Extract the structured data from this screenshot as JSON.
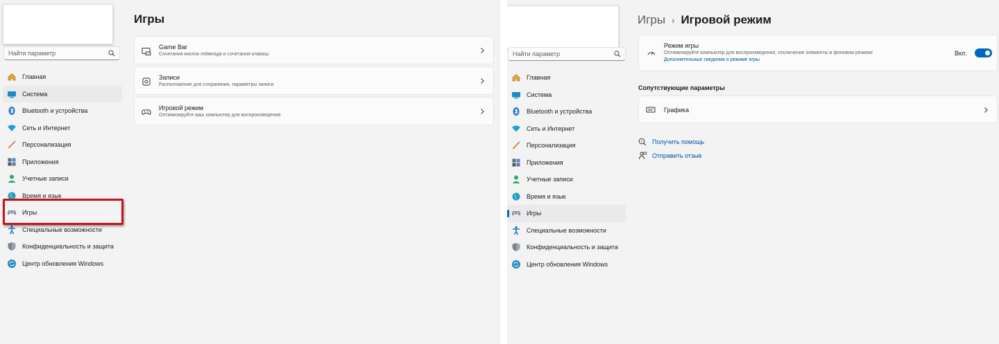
{
  "search": {
    "placeholder": "Найти параметр"
  },
  "nav": {
    "items": [
      {
        "label": "Главная",
        "icon": "home-icon"
      },
      {
        "label": "Система",
        "icon": "system-icon"
      },
      {
        "label": "Bluetooth и устройства",
        "icon": "bluetooth-icon"
      },
      {
        "label": "Сеть и Интернет",
        "icon": "wifi-icon"
      },
      {
        "label": "Персонализация",
        "icon": "brush-icon"
      },
      {
        "label": "Приложения",
        "icon": "apps-icon"
      },
      {
        "label": "Учетные записи",
        "icon": "account-icon"
      },
      {
        "label": "Время и язык",
        "icon": "globe-icon"
      },
      {
        "label": "Игры",
        "icon": "gamepad-icon"
      },
      {
        "label": "Специальные возможности",
        "icon": "accessibility-icon"
      },
      {
        "label": "Конфиденциальность и защита",
        "icon": "shield-icon"
      },
      {
        "label": "Центр обновления Windows",
        "icon": "update-icon"
      }
    ]
  },
  "left": {
    "title": "Игры",
    "cards": [
      {
        "title": "Game Bar",
        "desc": "Сочетания кнопок геймпада и сочетания клавиш",
        "icon": "game-bar-icon"
      },
      {
        "title": "Записи",
        "desc": "Расположение для сохранения, параметры записи",
        "icon": "capture-icon"
      },
      {
        "title": "Игровой режим",
        "desc": "Оптимизируйте ваш компьютер для воспроизведения",
        "icon": "game-mode-icon"
      }
    ]
  },
  "right": {
    "breadcrumb_parent": "Игры",
    "breadcrumb_sep": "›",
    "breadcrumb_current": "Игровой режим",
    "setting": {
      "title": "Режим игры",
      "desc": "Оптимизируйте компьютер для воспроизведения, отключение элементы в фоновом режиме",
      "link": "Дополнительные сведения о режиме игры",
      "toggle_label": "Вкл.",
      "toggle_on": true
    },
    "related_heading": "Сопутствующие параметры",
    "related_card": {
      "title": "Графика",
      "icon": "display-icon"
    },
    "help": {
      "get_help": "Получить помощь",
      "feedback": "Отправить отзыв"
    }
  },
  "colors": {
    "accent": "#0067c0",
    "highlight": "#c8121b",
    "link": "#0053a4",
    "window_bg": "#f3f3f3"
  }
}
